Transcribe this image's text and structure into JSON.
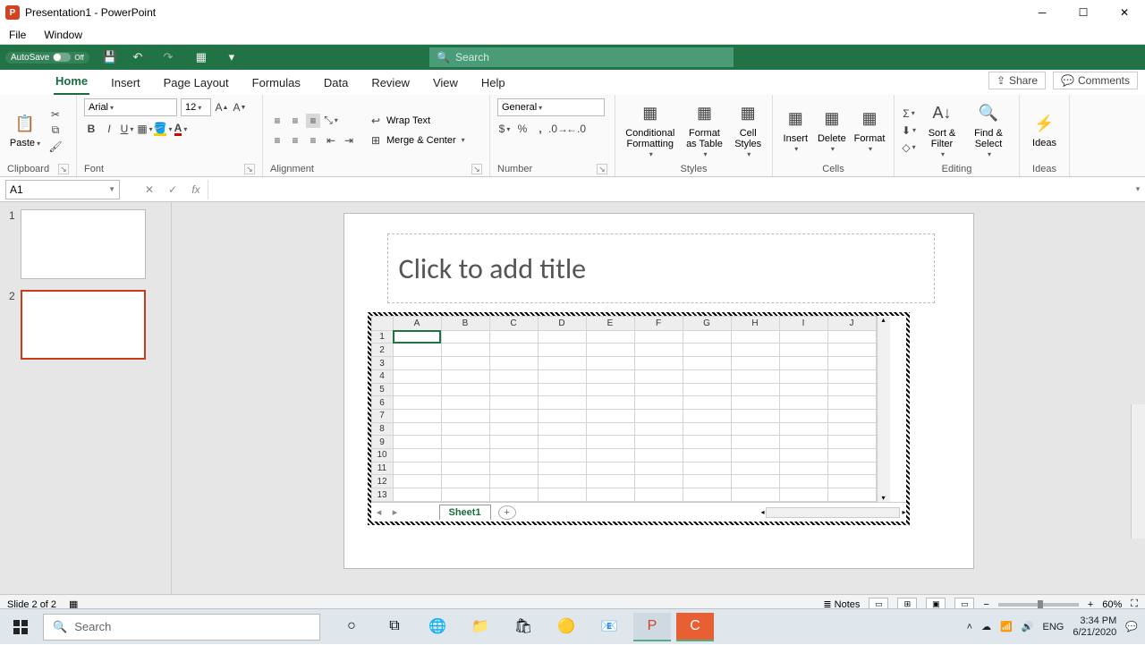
{
  "window": {
    "title": "Presentation1 - PowerPoint",
    "app_icon_letter": "P"
  },
  "menubar": {
    "file": "File",
    "window": "Window"
  },
  "qat": {
    "autosave": "AutoSave",
    "autosave_state": "Off",
    "search_placeholder": "Search"
  },
  "tabs": {
    "home": "Home",
    "insert": "Insert",
    "page_layout": "Page Layout",
    "formulas": "Formulas",
    "data": "Data",
    "review": "Review",
    "view": "View",
    "help": "Help",
    "share": "Share",
    "comments": "Comments"
  },
  "ribbon": {
    "clipboard": {
      "paste": "Paste",
      "label": "Clipboard"
    },
    "font": {
      "name": "Arial",
      "size": "12",
      "label": "Font"
    },
    "alignment": {
      "wrap": "Wrap Text",
      "merge": "Merge & Center",
      "label": "Alignment"
    },
    "number": {
      "format": "General",
      "label": "Number"
    },
    "styles": {
      "cond": "Conditional Formatting",
      "table": "Format as Table",
      "cell": "Cell Styles",
      "label": "Styles"
    },
    "cells": {
      "insert": "Insert",
      "delete": "Delete",
      "format": "Format",
      "label": "Cells"
    },
    "editing": {
      "sort": "Sort & Filter",
      "find": "Find & Select",
      "label": "Editing"
    },
    "ideas": {
      "ideas": "Ideas",
      "label": "Ideas"
    }
  },
  "namebox": {
    "ref": "A1",
    "fx": "fx"
  },
  "thumbs": {
    "n1": "1",
    "n2": "2"
  },
  "slide": {
    "title_placeholder": "Click to add title",
    "sheet": {
      "cols": [
        "A",
        "B",
        "C",
        "D",
        "E",
        "F",
        "G",
        "H",
        "I",
        "J"
      ],
      "rows_count": 13,
      "tab": "Sheet1"
    }
  },
  "statusbar": {
    "slide": "Slide 2 of 2",
    "notes": "Notes",
    "zoom": "60%"
  },
  "taskbar": {
    "search": "Search",
    "time": "3:34 PM",
    "date": "6/21/2020"
  }
}
